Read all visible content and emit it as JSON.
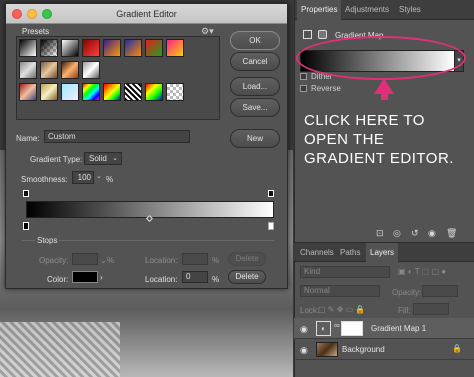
{
  "dialog": {
    "title": "Gradient Editor",
    "presets_label": "Presets",
    "buttons": {
      "ok": "OK",
      "cancel": "Cancel",
      "load": "Load...",
      "save": "Save...",
      "new": "New"
    },
    "name_label": "Name:",
    "name_value": "Custom",
    "gradient_type_label": "Gradient Type:",
    "gradient_type_value": "Solid",
    "smoothness_label": "Smoothness:",
    "smoothness_value": "100",
    "smoothness_unit": "%",
    "stops": {
      "label": "Stops",
      "opacity_label": "Opacity:",
      "opacity_unit": "%",
      "location_label": "Location:",
      "location_unit": "%",
      "color_label": "Color:",
      "color_value": "#000000",
      "color_location_value": "0",
      "delete_label": "Delete"
    },
    "gradient_colors": [
      "#000000",
      "#ffffff"
    ]
  },
  "properties": {
    "tabs": [
      "Properties",
      "Adjustments",
      "Styles"
    ],
    "adjustment_name": "Gradient Map",
    "options": [
      "Dither",
      "Reverse"
    ]
  },
  "annotation": {
    "text": "CLICK HERE TO OPEN THE GRADIENT EDITOR.",
    "color": "#e0307a"
  },
  "layers": {
    "tabs": [
      "Channels",
      "Paths",
      "Layers"
    ],
    "filter_kind": "Kind",
    "blend_mode": "Normal",
    "opacity_label": "Opacity:",
    "lock_label": "Lock:",
    "fill_label": "Fill:",
    "items": [
      {
        "name": "Gradient Map 1"
      },
      {
        "name": "Background"
      }
    ]
  }
}
